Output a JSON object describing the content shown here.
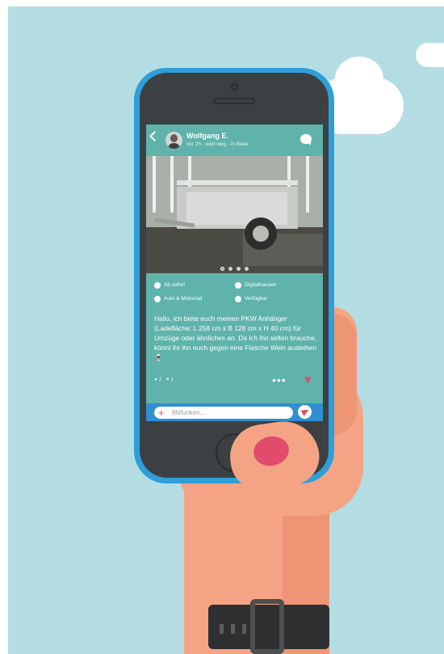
{
  "background_colors": {
    "sky": "#b4dde3",
    "teal": "#5fb3aa",
    "phone_blue": "#2f9fd9",
    "accent_red": "#e24b5d"
  },
  "post": {
    "back_icon": "chevron-left-icon",
    "author": "Wolfgang E.",
    "subtitle": "vor 2h · weit weg · in Biete",
    "chat_icon": "speech-bubble-icon",
    "image": "car-trailer-photo",
    "image_pages": 4,
    "image_active_page": 1,
    "meta": [
      {
        "icon": "calendar-icon",
        "label": "Ab sofort"
      },
      {
        "icon": "location-pin-icon",
        "label": "Digitalhausen"
      },
      {
        "icon": "cloud-icon",
        "label": "Auto & Motorrad"
      },
      {
        "icon": "plus-circle-icon",
        "label": "Verfügbar"
      }
    ],
    "description": "Hallo, ich biete euch meinen PKW Anhänger (Ladefläche: L 258 cm x B 128 cm x H 40 cm) für Umzüge oder ähnliches an. Da ich ihn selten brauche, könnt ihr ihn euch gegen eine Flasche Wein ausleihen🍷",
    "comments_count": "2",
    "likes_count": "1",
    "more_label": "•••",
    "heart_icon": "heart-icon"
  },
  "composer": {
    "add_icon": "plus-icon",
    "placeholder": "Mitfunken...",
    "send_icon": "send-icon"
  }
}
